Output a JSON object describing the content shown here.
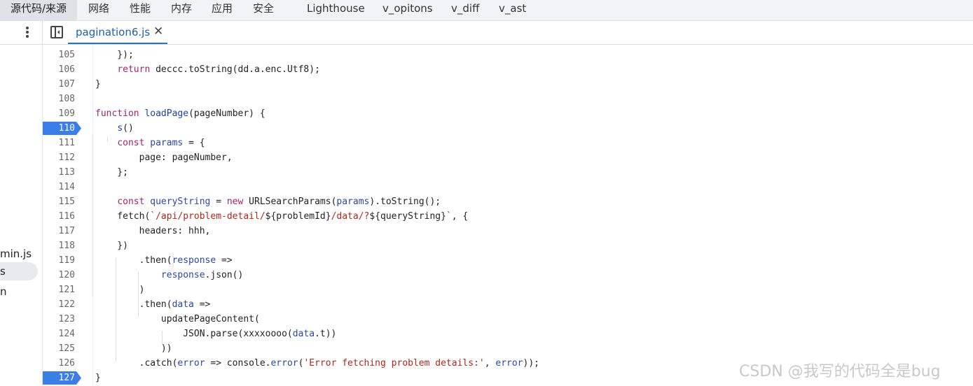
{
  "tabs": [
    "源代码/来源",
    "网络",
    "性能",
    "内存",
    "应用",
    "安全",
    "Lighthouse",
    "v_opitons",
    "v_diff",
    "v_ast"
  ],
  "active_tab_index": 0,
  "editor": {
    "file_name": "pagination6.js",
    "close_glyph": "✕"
  },
  "sidebar": {
    "items": [
      "min.js",
      "s",
      "n"
    ],
    "selected_index": 1
  },
  "breakpoints": [
    110,
    127
  ],
  "lines": [
    {
      "n": "105",
      "code": "    });"
    },
    {
      "n": "106",
      "code": "    return deccc.toString(dd.a.enc.Utf8);"
    },
    {
      "n": "107",
      "code": "}"
    },
    {
      "n": "108",
      "code": ""
    },
    {
      "n": "109",
      "code": "function loadPage(pageNumber) {"
    },
    {
      "n": "110",
      "code": "    s()"
    },
    {
      "n": "111",
      "code": "    const params = {"
    },
    {
      "n": "112",
      "code": "        page: pageNumber,"
    },
    {
      "n": "113",
      "code": "    };"
    },
    {
      "n": "114",
      "code": ""
    },
    {
      "n": "115",
      "code": "    const queryString = new URLSearchParams(params).toString();"
    },
    {
      "n": "116",
      "code": "    fetch(`/api/problem-detail/${problemId}/data/?${queryString}`, {"
    },
    {
      "n": "117",
      "code": "        headers: hhh,"
    },
    {
      "n": "118",
      "code": "    })"
    },
    {
      "n": "119",
      "code": "        .then(response =>"
    },
    {
      "n": "120",
      "code": "            response.json()"
    },
    {
      "n": "121",
      "code": "        )"
    },
    {
      "n": "122",
      "code": "        .then(data =>"
    },
    {
      "n": "123",
      "code": "            updatePageContent("
    },
    {
      "n": "124",
      "code": "                JSON.parse(xxxxoooo(data.t))"
    },
    {
      "n": "125",
      "code": "            ))"
    },
    {
      "n": "126",
      "code": "        .catch(error => console.error('Error fetching problem details:', error));"
    },
    {
      "n": "127",
      "code": "}"
    }
  ],
  "watermark": "CSDN @我写的代码全是bug"
}
